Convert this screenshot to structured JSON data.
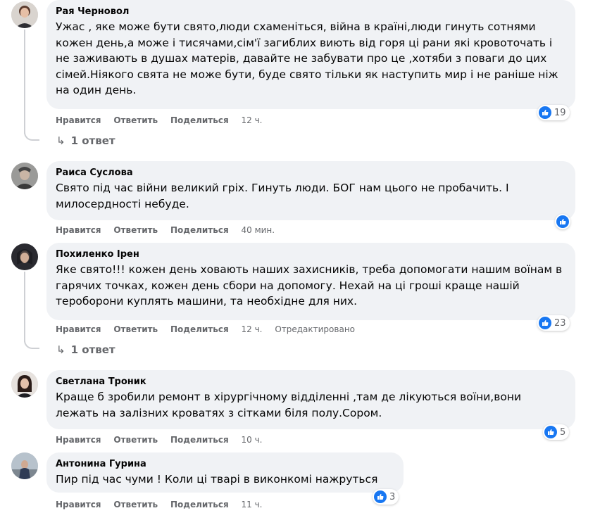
{
  "actions": {
    "like": "Нравится",
    "reply": "Ответить",
    "share": "Поделиться"
  },
  "comments": [
    {
      "author": "Рая Черновол",
      "text": "Ужас , яке може бути свято,люди схаменіться, війна в країні,люди гинуть сотнями кожен день,а може і тисячами,сім'ї загиблих виють від горя ці рани які кровоточать і не заживають в душах матерів, давайте не забувати про це ,хотяби з поваги до цих сімей.Ніякого свята не може бути, буде свято тільки як наступить мир і не раніше ніж на один день.",
      "time": "12 ч.",
      "reactions": "19",
      "replies": "1 ответ"
    },
    {
      "author": "Раиса Суслова",
      "text": "Свято під час війни великий гріх. Гинуть люди. БОГ нам цього не пробачить. І милосердності небуде.",
      "time": "40 мин."
    },
    {
      "author": "Похиленко Ірен",
      "text": "Яке свято!!! кожен день ховають наших захисників, треба допомогати нашим воїнам в гарячих точках, кожен день сбори на допомогу. Нехай на ці гроші краще нашій тероборони куплять машини, та необхідне для них.",
      "time": "12 ч.",
      "edited": "Отредактировано",
      "reactions": "23",
      "replies": "1 ответ"
    },
    {
      "author": "Светлана Троник",
      "text": "Краще б зробили ремонт в хірургічному відділенні ,там де лікуються воїни,вони лежать на залізних кроватях з сітками біля полу.Сором.",
      "time": "10 ч.",
      "reactions": "5"
    },
    {
      "author": "Антонина Гурина",
      "text": "Пир під час чуми ! Коли ці тварі в виконкомі нажруться",
      "time": "11 ч.",
      "reactions": "3"
    }
  ]
}
